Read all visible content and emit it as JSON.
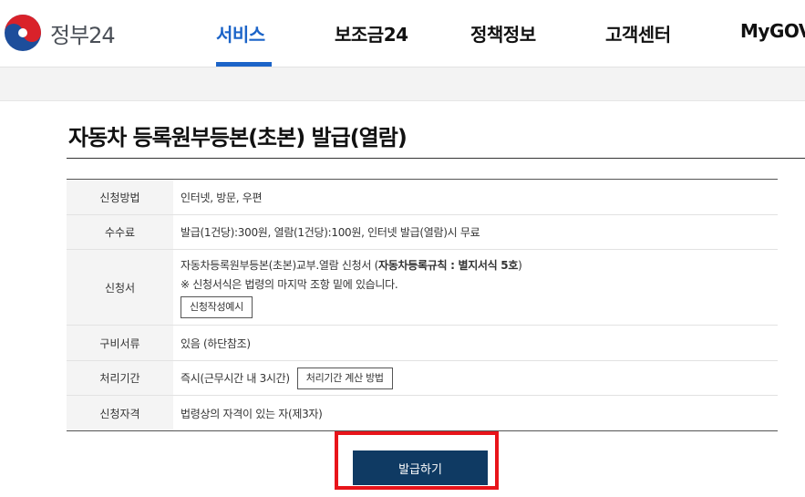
{
  "header": {
    "logo_text": "정부24",
    "nav": [
      {
        "label": "서비스"
      },
      {
        "label": "보조금24"
      },
      {
        "label": "정책정보"
      },
      {
        "label": "고객센터"
      },
      {
        "label": "MyGOV"
      }
    ],
    "colors": {
      "accent": "#1c64c8"
    }
  },
  "page": {
    "title": "자동차 등록원부등본(초본) 발급(열람)"
  },
  "table": {
    "rows": [
      {
        "label": "신청방법",
        "value": "인터넷, 방문, 우편"
      },
      {
        "label": "수수료",
        "value": "발급(1건당):300원, 열람(1건당):100원, 인터넷 발급(열람)시 무료"
      },
      {
        "label": "신청서",
        "value_plain": "자동차등록원부등본(초본)교부.열람 신청서 (",
        "value_bold": "자동차등록규칙 : 별지서식 5호",
        "value_close": ")",
        "note": "※ 신청서식은 법령의 마지막 조항 밑에 있습니다.",
        "button": "신청작성예시"
      },
      {
        "label": "구비서류",
        "value": "있음 (하단참조)"
      },
      {
        "label": "처리기간",
        "value": "즉시(근무시간 내 3시간)",
        "button": "처리기간 계산 방법"
      },
      {
        "label": "신청자격",
        "value": "법령상의 자격이 있는 자(제3자)"
      }
    ]
  },
  "actions": {
    "issue_label": "발급하기",
    "highlight_color": "#e8141a",
    "button_color": "#0f3a63"
  }
}
